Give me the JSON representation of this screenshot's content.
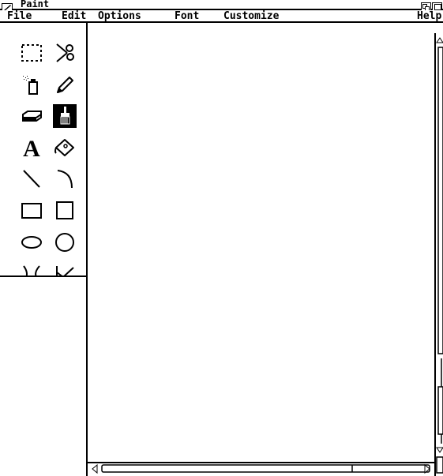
{
  "window": {
    "title": "Paint"
  },
  "menubar": {
    "items": [
      {
        "label": "File"
      },
      {
        "label": "Edit"
      },
      {
        "label": "Options"
      },
      {
        "label": "Font"
      },
      {
        "label": "Customize"
      },
      {
        "label": "Help"
      }
    ]
  },
  "toolbox": {
    "tools": [
      {
        "name": "rectangle-select-icon"
      },
      {
        "name": "scissors-icon"
      },
      {
        "name": "spray-can-icon"
      },
      {
        "name": "pencil-icon"
      },
      {
        "name": "eraser-icon"
      },
      {
        "name": "paintbrush-icon",
        "selected": true
      },
      {
        "name": "text-tool-icon",
        "glyph": "A"
      },
      {
        "name": "paint-bucket-icon"
      },
      {
        "name": "line-icon"
      },
      {
        "name": "arc-icon"
      },
      {
        "name": "rectangle-icon"
      },
      {
        "name": "square-icon"
      },
      {
        "name": "ellipse-icon"
      },
      {
        "name": "circle-icon"
      },
      {
        "name": "freeform-shape-icon"
      },
      {
        "name": "polygon-icon"
      }
    ]
  }
}
